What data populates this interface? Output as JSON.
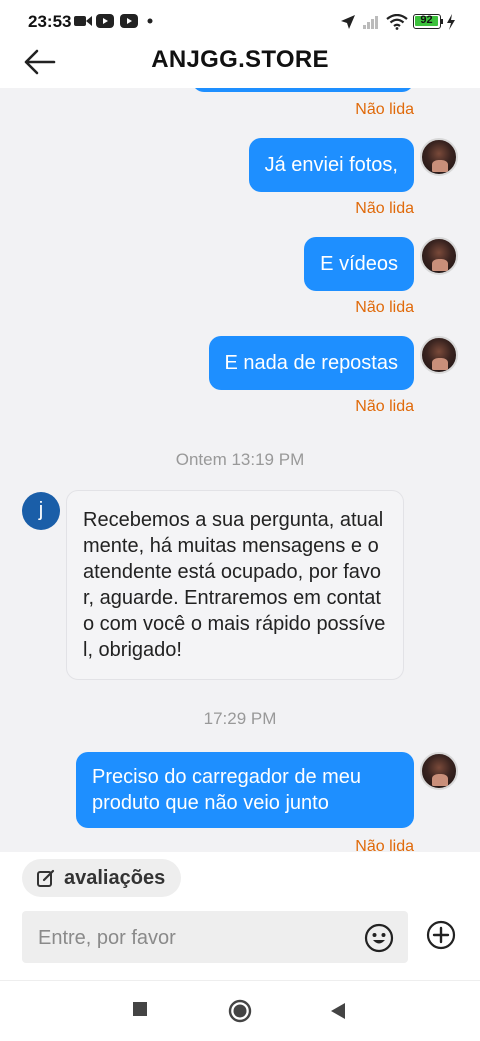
{
  "status_bar": {
    "time": "23:53",
    "battery": "92",
    "icons": [
      "video-camera-icon",
      "youtube-icon",
      "youtube-icon",
      "dot-icon",
      "location-arrow-icon",
      "signal-icon",
      "wifi-icon",
      "battery-icon",
      "charging-icon"
    ]
  },
  "header": {
    "title": "ANJGG.STORE",
    "back_icon": "back-arrow-icon"
  },
  "messages": {
    "unread_label": "Não lida",
    "out_1": "Já enviei fotos,",
    "out_2": "E vídeos",
    "out_3": "E nada de repostas",
    "timestamp_1": "Ontem 13:19 PM",
    "bot_initial": "j",
    "bot_message": "Recebemos a sua pergunta, atualmente, há muitas mensagens e o atendente está ocupado, por favor, aguarde. Entraremos em contato com você o mais rápido possível, obrigado!",
    "timestamp_2": "17:29 PM",
    "out_4": "Preciso do carregador de meu produto que não veio junto"
  },
  "composer": {
    "chip_label": "avaliações",
    "input_placeholder": "Entre, por favor",
    "input_value": ""
  },
  "nav_bar": {
    "icons": [
      "square-icon",
      "circle-icon",
      "triangle-back-icon"
    ]
  },
  "colors": {
    "bubble_out": "#1e8fff",
    "unread": "#e06a0a",
    "bot_avatar": "#1a5ea8",
    "background": "#f2f2f4"
  }
}
